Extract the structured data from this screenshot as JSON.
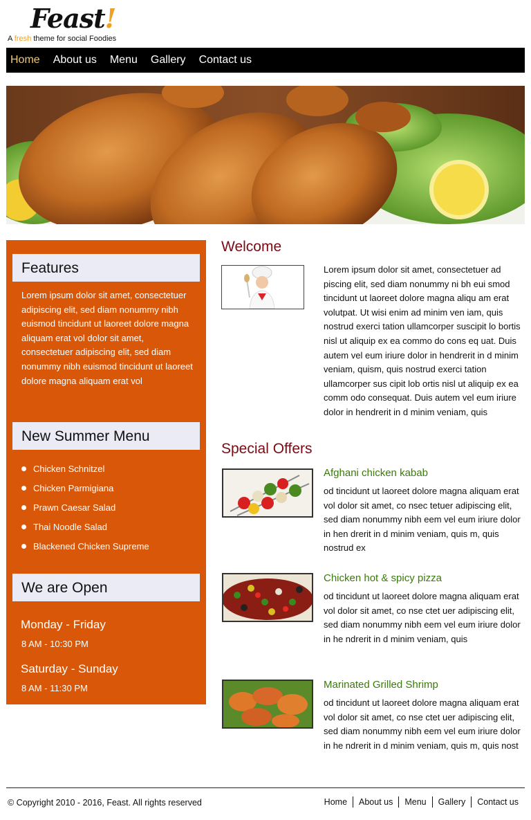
{
  "header": {
    "logo_text": "Feast",
    "logo_bang": "!",
    "tagline_pre": "A ",
    "tagline_fresh": "fresh",
    "tagline_post": " theme for social Foodies"
  },
  "nav": {
    "items": [
      {
        "label": "Home",
        "active": true
      },
      {
        "label": "About us"
      },
      {
        "label": "Menu"
      },
      {
        "label": "Gallery"
      },
      {
        "label": "Contact us"
      }
    ]
  },
  "sidebar": {
    "features": {
      "title": "Features",
      "text": "Lorem ipsum dolor sit amet, consectetuer adipiscing elit, sed diam nonummy nibh euismod tincidunt ut laoreet dolore magna aliquam erat vol dolor sit amet, consectetuer adipiscing elit, sed diam nonummy nibh euismod tincidunt ut laoreet dolore magna aliquam erat vol"
    },
    "summer_menu": {
      "title": "New Summer Menu",
      "items": [
        "Chicken Schnitzel",
        "Chicken Parmigiana",
        "Prawn Caesar Salad",
        "Thai Noodle Salad",
        "Blackened Chicken Supreme"
      ]
    },
    "open": {
      "title": "We are Open",
      "weekday_label": "Monday - Friday",
      "weekday_hours": "8 AM - 10:30 PM",
      "weekend_label": "Saturday - Sunday",
      "weekend_hours": "8 AM - 11:30 PM"
    }
  },
  "main": {
    "welcome": {
      "title": "Welcome",
      "text": "Lorem ipsum dolor sit amet, consectetuer ad piscing elit, sed diam nonummy ni bh eui smod tincidunt ut laoreet dolore magna aliqu am erat volutpat. Ut wisi enim ad minim ven iam, quis nostrud exerci tation ullamcorper suscipit lo bortis nisl ut aliquip ex ea commo do cons eq uat. Duis autem vel eum iriure dolor in hendrerit  in d minim veniam, quism, quis nostrud exerci tation ullamcorper sus cipit lob ortis nisl ut aliquip ex ea comm odo consequat. Duis autem vel eum iriure dolor in hendrerit in d minim veniam, quis"
    },
    "offers_title": "Special Offers",
    "offers": [
      {
        "title": "Afghani chicken kabab",
        "text": "od tincidunt ut laoreet dolore magna aliquam erat vol  dolor sit amet, co nsec tetuer adipiscing elit, sed diam nonummy nibh eem vel eum iriure dolor in hen drerit in d minim veniam, quis  m, quis nostrud ex"
      },
      {
        "title": "Chicken hot & spicy pizza",
        "text": "od tincidunt ut laoreet dolore magna aliquam erat vol  dolor sit amet, co nse ctet uer adipiscing elit, sed diam nonummy nibh eem vel eum iriure dolor in he ndrerit in d minim veniam, quis"
      },
      {
        "title": "Marinated Grilled Shrimp",
        "text": "od tincidunt ut laoreet dolore magna aliquam erat vol  dolor sit amet, co nse ctet uer adipiscing elit, sed diam nonummy nibh eem vel eum iriure dolor in he ndrerit in d minim veniam, quis  m, quis nost"
      }
    ]
  },
  "footer": {
    "copyright": "© Copyright 2010 - 2016, Feast. All rights reserved",
    "links": [
      "Home",
      "About us",
      "Menu",
      "Gallery",
      "Contact us"
    ]
  },
  "colors": {
    "sidebar_orange": "#d95709",
    "heading_maroon": "#7a0a14",
    "offer_green": "#3a7a0c",
    "nav_active": "#f0c878"
  }
}
